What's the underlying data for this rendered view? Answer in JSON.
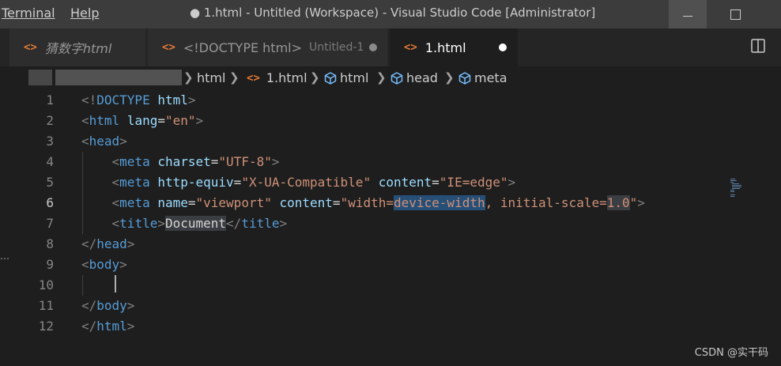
{
  "menu": {
    "terminal": "Terminal",
    "help": "Help"
  },
  "window": {
    "title": "● 1.html - Untitled (Workspace) - Visual Studio Code [Administrator]"
  },
  "tabs": [
    {
      "label": "猜数字html",
      "italic": true
    },
    {
      "label": "<!DOCTYPE html>",
      "description": "Untitled-1",
      "dirty": true
    },
    {
      "label": "1.html",
      "dirty": true,
      "active": true
    }
  ],
  "breadcrumb": [
    "html",
    "1.html",
    "html",
    "head",
    "meta"
  ],
  "code": {
    "line_numbers": [
      "1",
      "2",
      "3",
      "4",
      "5",
      "6",
      "7",
      "8",
      "9",
      "10",
      "11",
      "12"
    ],
    "current_line": "6",
    "lines": [
      [
        [
          "bracket",
          "<!"
        ],
        [
          "tag",
          "DOCTYPE"
        ],
        [
          "text",
          " "
        ],
        [
          "attr",
          "html"
        ],
        [
          "bracket",
          ">"
        ]
      ],
      [
        [
          "bracket",
          "<"
        ],
        [
          "tag",
          "html"
        ],
        [
          "text",
          " "
        ],
        [
          "attr",
          "lang"
        ],
        [
          "text",
          "="
        ],
        [
          "str",
          "\"en\""
        ],
        [
          "bracket",
          ">"
        ]
      ],
      [
        [
          "bracket",
          "<"
        ],
        [
          "tag",
          "head"
        ],
        [
          "bracket",
          ">"
        ]
      ],
      [
        [
          "text",
          "    "
        ],
        [
          "bracket",
          "<"
        ],
        [
          "tag",
          "meta"
        ],
        [
          "text",
          " "
        ],
        [
          "attr",
          "charset"
        ],
        [
          "text",
          "="
        ],
        [
          "str",
          "\"UTF-8\""
        ],
        [
          "bracket",
          ">"
        ]
      ],
      [
        [
          "text",
          "    "
        ],
        [
          "bracket",
          "<"
        ],
        [
          "tag",
          "meta"
        ],
        [
          "text",
          " "
        ],
        [
          "attr",
          "http-equiv"
        ],
        [
          "text",
          "="
        ],
        [
          "str",
          "\"X-UA-Compatible\""
        ],
        [
          "text",
          " "
        ],
        [
          "attr",
          "content"
        ],
        [
          "text",
          "="
        ],
        [
          "str",
          "\"IE=edge\""
        ],
        [
          "bracket",
          ">"
        ]
      ],
      [
        [
          "text",
          "    "
        ],
        [
          "bracket",
          "<"
        ],
        [
          "tag",
          "meta"
        ],
        [
          "text",
          " "
        ],
        [
          "attr",
          "name"
        ],
        [
          "text",
          "="
        ],
        [
          "str",
          "\"viewport\""
        ],
        [
          "text",
          " "
        ],
        [
          "attr",
          "content"
        ],
        [
          "text",
          "="
        ],
        [
          "str",
          "\"width="
        ],
        [
          "str",
          "device-width",
          "sel"
        ],
        [
          "str",
          ", initial-scale="
        ],
        [
          "str",
          "1.0",
          "word"
        ],
        [
          "str",
          "\""
        ],
        [
          "bracket",
          ">"
        ]
      ],
      [
        [
          "text",
          "    "
        ],
        [
          "bracket",
          "<"
        ],
        [
          "tag",
          "title"
        ],
        [
          "bracket",
          ">"
        ],
        [
          "text",
          "Document",
          "word"
        ],
        [
          "bracket",
          "</"
        ],
        [
          "tag",
          "title"
        ],
        [
          "bracket",
          ">"
        ]
      ],
      [
        [
          "bracket",
          "</"
        ],
        [
          "tag",
          "head"
        ],
        [
          "bracket",
          ">"
        ]
      ],
      [
        [
          "bracket",
          "<"
        ],
        [
          "tag",
          "body"
        ],
        [
          "bracket",
          ">"
        ]
      ],
      [],
      [
        [
          "bracket",
          "</"
        ],
        [
          "tag",
          "body"
        ],
        [
          "bracket",
          ">"
        ]
      ],
      [
        [
          "bracket",
          "</"
        ],
        [
          "tag",
          "html"
        ],
        [
          "bracket",
          ">"
        ]
      ]
    ]
  },
  "watermark": "CSDN @实干码",
  "colors": {
    "accent_icon": "#e37933",
    "tag": "#569cd6",
    "attr": "#9cdcfe",
    "string": "#ce9178",
    "selection": "#264f78"
  }
}
